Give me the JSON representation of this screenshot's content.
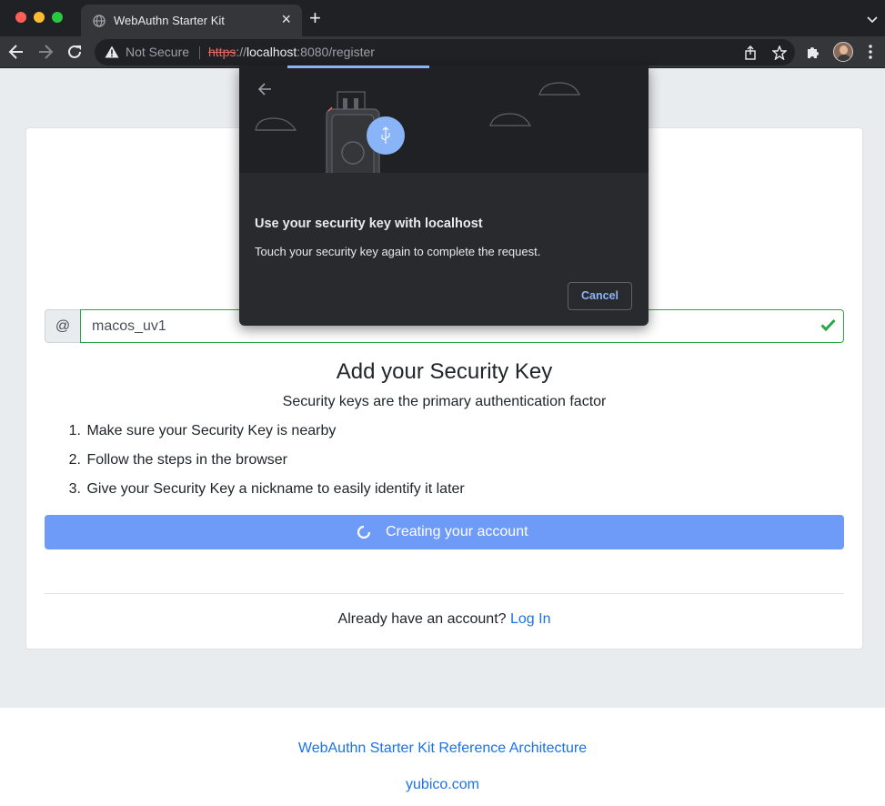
{
  "browser": {
    "tab_title": "WebAuthn Starter Kit",
    "new_tab_symbol": "+",
    "close_symbol": "×",
    "security_label": "Not Secure",
    "url": {
      "scheme": "https",
      "separator": "://",
      "host": "localhost",
      "rest": ":8080/register"
    }
  },
  "form": {
    "prefix": "@",
    "username_value": "macos_uv1",
    "heading": "Add your Security Key",
    "subtext": "Security keys are the primary authentication factor",
    "steps": [
      {
        "num": "1.",
        "text": "Make sure your Security Key is nearby"
      },
      {
        "num": "2.",
        "text": "Follow the steps in the browser"
      },
      {
        "num": "3.",
        "text": "Give your Security Key a nickname to easily identify it later"
      }
    ],
    "create_button_label": "Creating your account",
    "login_prompt": "Already have an account?",
    "login_link": "Log In"
  },
  "footer": {
    "link1": "WebAuthn Starter Kit Reference Architecture",
    "link2": "yubico.com"
  },
  "dialog": {
    "title": "Use your security key with localhost",
    "description": "Touch your security key again to complete the request.",
    "cancel_label": "Cancel"
  },
  "colors": {
    "accent": "#6e9af8",
    "link": "#1a73e8",
    "valid": "#28a745",
    "dialog_bg": "#292a2d"
  }
}
